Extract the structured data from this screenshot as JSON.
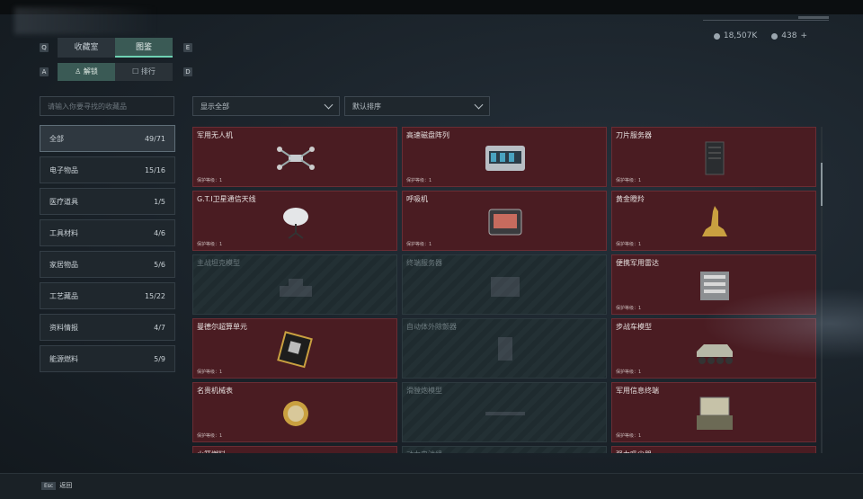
{
  "currency": {
    "primary_value": "18,507K",
    "secondary_value": "438",
    "add_label": "+"
  },
  "nav": {
    "key_left_1": "Q",
    "key_right_1": "E",
    "key_left_2": "A",
    "key_right_2": "D",
    "tabs": [
      "收藏室",
      "图鉴"
    ],
    "subtabs": [
      "解锁",
      "排行"
    ]
  },
  "search": {
    "placeholder": "请输入你要寻找的收藏品"
  },
  "filters": {
    "show": "显示全部",
    "sort": "默认排序"
  },
  "categories": [
    {
      "label": "全部",
      "count": "49/71"
    },
    {
      "label": "电子物品",
      "count": "15/16"
    },
    {
      "label": "医疗道具",
      "count": "1/5"
    },
    {
      "label": "工具材料",
      "count": "4/6"
    },
    {
      "label": "家居物品",
      "count": "5/6"
    },
    {
      "label": "工艺藏品",
      "count": "15/22"
    },
    {
      "label": "资料情报",
      "count": "4/7"
    },
    {
      "label": "能源燃料",
      "count": "5/9"
    }
  ],
  "cards": [
    {
      "name": "军用无人机",
      "level": "保护等级：1",
      "owned": true,
      "icon": "drone-icon"
    },
    {
      "name": "高速磁盘阵列",
      "level": "保护等级：1",
      "owned": true,
      "icon": "disk-array-icon"
    },
    {
      "name": "刀片服务器",
      "level": "保护等级：1",
      "owned": true,
      "icon": "server-icon"
    },
    {
      "name": "G.T.I卫星通信天线",
      "level": "保护等级：1",
      "owned": true,
      "icon": "satellite-dish-icon"
    },
    {
      "name": "呼吸机",
      "level": "保护等级：1",
      "owned": true,
      "icon": "ventilator-icon"
    },
    {
      "name": "黄金瞪羚",
      "level": "保护等级：1",
      "owned": true,
      "icon": "golden-gazelle-icon"
    },
    {
      "name": "主战坦克模型",
      "level": "",
      "owned": false,
      "icon": "tank-model-icon"
    },
    {
      "name": "终端服务器",
      "level": "",
      "owned": false,
      "icon": "terminal-server-icon"
    },
    {
      "name": "便携军用雷达",
      "level": "保护等级：1",
      "owned": true,
      "icon": "radar-icon"
    },
    {
      "name": "曼德尔超算单元",
      "level": "保护等级：1",
      "owned": true,
      "icon": "supercomputer-unit-icon"
    },
    {
      "name": "自动体外除颤器",
      "level": "",
      "owned": false,
      "icon": "defibrillator-icon"
    },
    {
      "name": "步战车模型",
      "level": "保护等级：1",
      "owned": true,
      "icon": "ifv-model-icon"
    },
    {
      "name": "名贵机械表",
      "level": "保护等级：1",
      "owned": true,
      "icon": "watch-icon"
    },
    {
      "name": "滑膛炮模型",
      "level": "",
      "owned": false,
      "icon": "cannon-model-icon"
    },
    {
      "name": "军用信息终端",
      "level": "保护等级：1",
      "owned": true,
      "icon": "info-terminal-icon"
    },
    {
      "name": "火箭燃料",
      "level": "",
      "owned": true,
      "icon": "rocket-fuel-icon"
    },
    {
      "name": "动力电池组",
      "level": "",
      "owned": false,
      "icon": "battery-pack-icon"
    },
    {
      "name": "强力吸尘器",
      "level": "",
      "owned": true,
      "icon": "vacuum-icon"
    }
  ],
  "footer": {
    "esc_key": "Esc",
    "back_label": "返回"
  },
  "colors": {
    "owned_card": "#4a1c22",
    "accent": "#6fd2b4",
    "background": "#1a2229"
  }
}
